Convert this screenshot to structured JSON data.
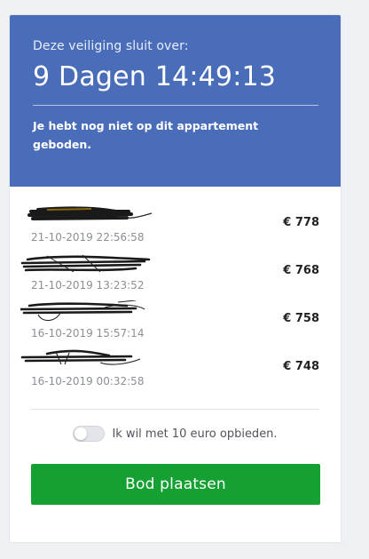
{
  "header": {
    "label": "Deze veiliging sluit over:",
    "countdown": "9 Dagen 14:49:13",
    "note": "Je hebt nog niet op dit appartement geboden."
  },
  "bids": [
    {
      "amount": "€ 778",
      "timestamp": "21-10-2019 22:56:58"
    },
    {
      "amount": "€ 768",
      "timestamp": "21-10-2019 13:23:52"
    },
    {
      "amount": "€ 758",
      "timestamp": "16-10-2019 15:57:14"
    },
    {
      "amount": "€ 748",
      "timestamp": "16-10-2019 00:32:58"
    }
  ],
  "autobid": {
    "label": "Ik wil met 10 euro opbieden.",
    "enabled": false
  },
  "cta": {
    "label": "Bod plaatsen"
  },
  "colors": {
    "header_bg": "#4a6db9",
    "cta_bg": "#14a032"
  }
}
